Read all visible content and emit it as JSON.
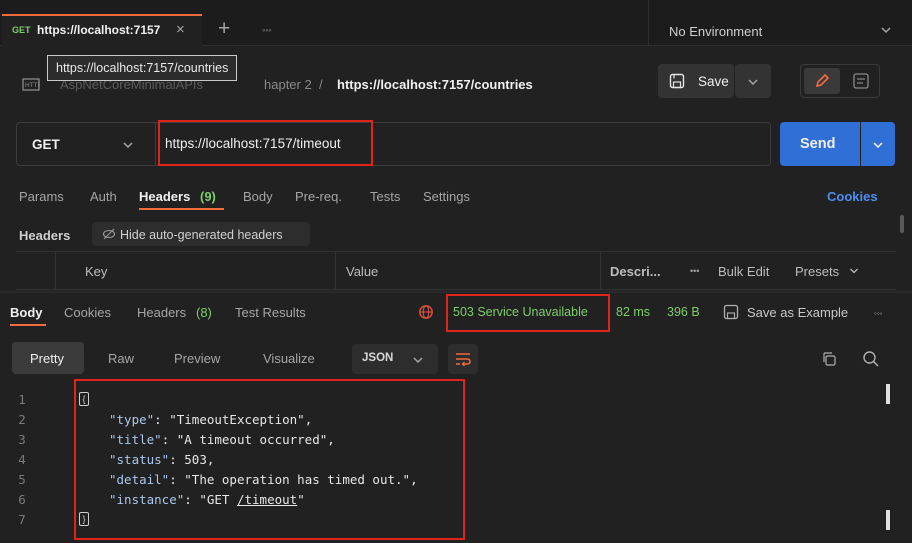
{
  "tabbar": {
    "tab_method": "GET",
    "tab_title": "https://localhost:7157",
    "close_symbol": "×",
    "new_tab_symbol": "+",
    "more_symbol": "◦◦◦",
    "environment": "No Environment"
  },
  "tooltip": {
    "text": "https://localhost:7157/countries"
  },
  "breadcrumb": {
    "collection_partial": "AspNetCoreMinimalAPIs",
    "folder_partial": "hapter 2",
    "separator": "/",
    "current": "https://localhost:7157/countries"
  },
  "toolbar": {
    "save_label": "Save"
  },
  "request": {
    "method": "GET",
    "url": "https://localhost:7157/timeout",
    "send_label": "Send"
  },
  "request_tabs": {
    "params": "Params",
    "auth": "Auth",
    "headers": "Headers",
    "headers_count": "(9)",
    "body": "Body",
    "prereq": "Pre-req.",
    "tests": "Tests",
    "settings": "Settings",
    "cookies": "Cookies"
  },
  "headers_section": {
    "title": "Headers",
    "hide_label": "Hide auto-generated headers",
    "col_key": "Key",
    "col_value": "Value",
    "col_desc": "Descri...",
    "more": "•••",
    "bulk_edit": "Bulk Edit",
    "presets": "Presets"
  },
  "response_tabs": {
    "body": "Body",
    "cookies": "Cookies",
    "headers": "Headers",
    "headers_count": "(8)",
    "test_results": "Test Results"
  },
  "response_status": {
    "status": "503 Service Unavailable",
    "time": "82 ms",
    "size": "396 B",
    "save_example": "Save as Example",
    "more": "◦◦◦"
  },
  "view_tabs": {
    "pretty": "Pretty",
    "raw": "Raw",
    "preview": "Preview",
    "visualize": "Visualize",
    "format": "JSON"
  },
  "code": {
    "line_numbers": [
      "1",
      "2",
      "3",
      "4",
      "5",
      "6",
      "7"
    ],
    "open_brace": "{",
    "close_brace": "}",
    "lines": [
      {
        "key": "\"type\"",
        "sep": ": ",
        "value": "\"TimeoutException\"",
        "trail": ","
      },
      {
        "key": "\"title\"",
        "sep": ": ",
        "value": "\"A timeout occurred\"",
        "trail": ","
      },
      {
        "key": "\"status\"",
        "sep": ": ",
        "value": "503",
        "trail": ","
      },
      {
        "key": "\"detail\"",
        "sep": ": ",
        "value": "\"The operation has timed out.\"",
        "trail": ","
      },
      {
        "key": "\"instance\"",
        "sep": ": ",
        "value_open": "\"GET ",
        "value_link": "/timeout",
        "value_close": "\"",
        "trail": ""
      }
    ]
  },
  "colors": {
    "accent": "#f26b3a",
    "send_blue": "#2f6fd6",
    "highlight_red": "#e0231b",
    "status_green": "#7dcf6a"
  }
}
